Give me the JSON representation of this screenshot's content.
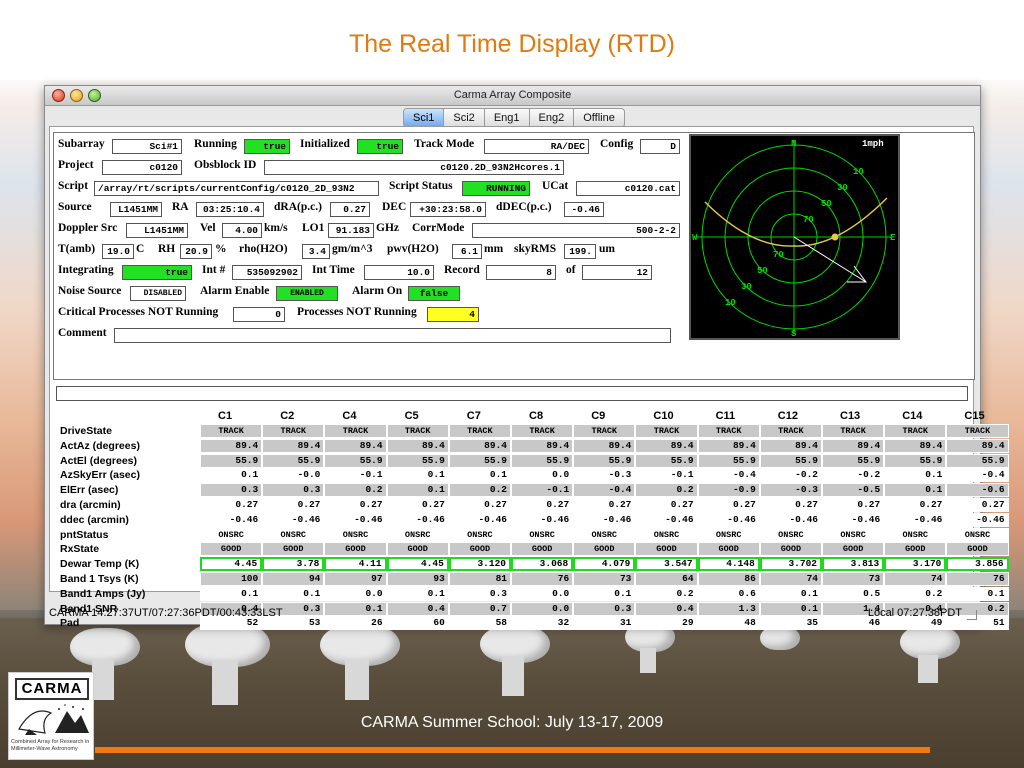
{
  "slide": {
    "title": "The Real Time Display (RTD)",
    "footer": "CARMA Summer School: July 13-17, 2009",
    "logo_word": "CARMA",
    "logo_caption": "Combined Array for Research in Millimeter-Wave Astronomy"
  },
  "window": {
    "title": "Carma Array Composite",
    "tabs": [
      {
        "label": "Sci1",
        "active": true
      },
      {
        "label": "Sci2",
        "active": false
      },
      {
        "label": "Eng1",
        "active": false
      },
      {
        "label": "Eng2",
        "active": false
      },
      {
        "label": "Offline",
        "active": false
      }
    ]
  },
  "labels": {
    "subarray": "Subarray",
    "running": "Running",
    "initialized": "Initialized",
    "track_mode": "Track Mode",
    "config": "Config",
    "project": "Project",
    "obsblock": "Obsblock ID",
    "script": "Script",
    "script_status": "Script Status",
    "ucat": "UCat",
    "source": "Source",
    "ra": "RA",
    "dra": "dRA(p.c.)",
    "dec": "DEC",
    "ddec": "dDEC(p.c.)",
    "doppler": "Doppler Src",
    "vel": "Vel",
    "vel_unit": "km/s",
    "lo1": "LO1",
    "lo1_unit": "GHz",
    "corrmode": "CorrMode",
    "tamb": "T(amb)",
    "tamb_unit": "C",
    "rh": "RH",
    "rh_unit": "%",
    "rho": "rho(H2O)",
    "rho_unit": "gm/m^3",
    "pwv": "pwv(H2O)",
    "pwv_unit": "mm",
    "skyrms": "skyRMS",
    "skyrms_unit": "um",
    "integrating": "Integrating",
    "int_num": "Int #",
    "int_time": "Int Time",
    "record": "Record",
    "of": "of",
    "noise": "Noise Source",
    "alarm_enable": "Alarm Enable",
    "alarm_on": "Alarm On",
    "crit": "Critical Processes NOT Running",
    "procs": "Processes NOT Running",
    "comment": "Comment"
  },
  "values": {
    "subarray": "Sci#1",
    "running": "true",
    "initialized": "true",
    "track_mode": "RA/DEC",
    "config": "D",
    "project": "c0120",
    "obsblock": "c0120.2D_93N2Hcores.1",
    "script": "/array/rt/scripts/currentConfig/c0120_2D_93N2",
    "script_status": "RUNNING",
    "ucat": "c0120.cat",
    "source": "L1451MM",
    "ra": "03:25:10.4",
    "dra": "0.27",
    "dec": "+30:23:58.0",
    "ddec": "-0.46",
    "doppler": "L1451MM",
    "vel": "4.00",
    "lo1": "91.183",
    "corrmode": "500-2-2",
    "tamb": "19.0",
    "rh": "20.9",
    "rho": "3.4",
    "pwv": "6.1",
    "skyrms": "199.",
    "integrating": "true",
    "int_num": "535092902",
    "int_time": "10.0",
    "record": "8",
    "of": "12",
    "noise": "DISABLED",
    "alarm_enable": "ENABLED",
    "alarm_on": "false",
    "crit": "0",
    "procs": "4",
    "comment": ""
  },
  "polar": {
    "wind": "1mph",
    "dir_n": "N",
    "dir_s": "S",
    "dir_e": "E",
    "dir_w": "W",
    "ring_labels_top": [
      "10",
      "30",
      "50",
      "70"
    ],
    "ring_labels_bottom": [
      "70",
      "50",
      "30",
      "10"
    ],
    "colors": {
      "grid": "#00d800",
      "arc": "#e8c84a",
      "pointer": "#ffffff",
      "bg": "#000000"
    }
  },
  "table": {
    "columns": [
      "C1",
      "C2",
      "C4",
      "C5",
      "C7",
      "C8",
      "C9",
      "C10",
      "C11",
      "C12",
      "C13",
      "C14",
      "C15"
    ],
    "rows": [
      {
        "label": "DriveState",
        "style": "c",
        "values": [
          "TRACK",
          "TRACK",
          "TRACK",
          "TRACK",
          "TRACK",
          "TRACK",
          "TRACK",
          "TRACK",
          "TRACK",
          "TRACK",
          "TRACK",
          "TRACK",
          "TRACK"
        ]
      },
      {
        "label": "ActAz (degrees)",
        "style": "n",
        "values": [
          "89.4",
          "89.4",
          "89.4",
          "89.4",
          "89.4",
          "89.4",
          "89.4",
          "89.4",
          "89.4",
          "89.4",
          "89.4",
          "89.4",
          "89.4"
        ]
      },
      {
        "label": "ActEl (degrees)",
        "style": "n",
        "values": [
          "55.9",
          "55.9",
          "55.9",
          "55.9",
          "55.9",
          "55.9",
          "55.9",
          "55.9",
          "55.9",
          "55.9",
          "55.9",
          "55.9",
          "55.9"
        ]
      },
      {
        "label": "AzSkyErr (asec)",
        "style": "w",
        "values": [
          "0.1",
          "-0.0",
          "-0.1",
          "0.1",
          "0.1",
          "0.0",
          "-0.3",
          "-0.1",
          "-0.4",
          "-0.2",
          "-0.2",
          "0.1",
          "-0.4"
        ]
      },
      {
        "label": "ElErr (asec)",
        "style": "n",
        "values": [
          "0.3",
          "0.3",
          "0.2",
          "0.1",
          "0.2",
          "-0.1",
          "-0.4",
          "0.2",
          "-0.9",
          "-0.3",
          "-0.5",
          "0.1",
          "-0.6"
        ]
      },
      {
        "label": "dra (arcmin)",
        "style": "w",
        "values": [
          "0.27",
          "0.27",
          "0.27",
          "0.27",
          "0.27",
          "0.27",
          "0.27",
          "0.27",
          "0.27",
          "0.27",
          "0.27",
          "0.27",
          "0.27"
        ]
      },
      {
        "label": "ddec (arcmin)",
        "style": "w",
        "values": [
          "-0.46",
          "-0.46",
          "-0.46",
          "-0.46",
          "-0.46",
          "-0.46",
          "-0.46",
          "-0.46",
          "-0.46",
          "-0.46",
          "-0.46",
          "-0.46",
          "-0.46"
        ]
      },
      {
        "label": "pntStatus",
        "style": "wc",
        "values": [
          "ONSRC",
          "ONSRC",
          "ONSRC",
          "ONSRC",
          "ONSRC",
          "ONSRC",
          "ONSRC",
          "ONSRC",
          "ONSRC",
          "ONSRC",
          "ONSRC",
          "ONSRC",
          "ONSRC"
        ]
      },
      {
        "label": "RxState",
        "style": "c",
        "values": [
          "GOOD",
          "GOOD",
          "GOOD",
          "GOOD",
          "GOOD",
          "GOOD",
          "GOOD",
          "GOOD",
          "GOOD",
          "GOOD",
          "GOOD",
          "GOOD",
          "GOOD"
        ]
      },
      {
        "label": "Dewar Temp (K)",
        "style": "g",
        "values": [
          "4.45",
          "3.78",
          "4.11",
          "4.45",
          "3.120",
          "3.068",
          "4.079",
          "3.547",
          "4.148",
          "3.702",
          "3.813",
          "3.170",
          "3.856"
        ]
      },
      {
        "label": "Band 1 Tsys (K)",
        "style": "n",
        "values": [
          "100",
          "94",
          "97",
          "93",
          "81",
          "76",
          "73",
          "64",
          "86",
          "74",
          "73",
          "74",
          "76"
        ]
      },
      {
        "label": "Band1 Amps (Jy)",
        "style": "w",
        "values": [
          "0.1",
          "0.1",
          "0.0",
          "0.1",
          "0.3",
          "0.0",
          "0.1",
          "0.2",
          "0.6",
          "0.1",
          "0.5",
          "0.2",
          "0.1"
        ]
      },
      {
        "label": "Band1 SNR",
        "style": "n",
        "values": [
          "0.4",
          "0.3",
          "0.1",
          "0.4",
          "0.7",
          "0.0",
          "0.3",
          "0.4",
          "1.3",
          "0.1",
          "1.4",
          "0.4",
          "0.2"
        ]
      },
      {
        "label": "Pad",
        "style": "w",
        "values": [
          "52",
          "53",
          "26",
          "60",
          "58",
          "32",
          "31",
          "29",
          "48",
          "35",
          "46",
          "49",
          "51"
        ]
      }
    ]
  },
  "status": {
    "left": "CARMA 14:27:37UT/07:27:36PDT/00:43:33LST",
    "right": "Local 07:27:38PDT"
  }
}
